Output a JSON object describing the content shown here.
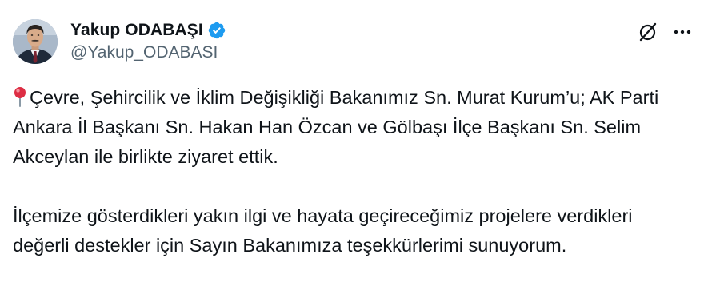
{
  "author": {
    "display_name": "Yakup ODABAŞI",
    "handle": "@Yakup_ODABASI",
    "verified": true
  },
  "icons": {
    "verified": "verified-badge-icon",
    "grok": "grok-icon",
    "more": "more-options-icon",
    "pin": "round-pushpin-emoji"
  },
  "tweet": {
    "paragraph_1": "Çevre, Şehircilik ve İklim Değişikliği Bakanımız Sn. Murat Kurum’u; AK Parti Ankara İl Başkanı Sn. Hakan Han Özcan ve Gölbaşı İlçe Başkanı Sn. Selim Akceylan ile birlikte ziyaret ettik.",
    "paragraph_2": "İlçemize gösterdikleri yakın ilgi ve hayata geçireceğimiz projelere verdikleri değerli destekler için Sayın Bakanımıza teşekkürlerimi sunuyorum."
  },
  "colors": {
    "verified_blue": "#1d9bf0",
    "text_primary": "#0f1419",
    "text_secondary": "#536471"
  }
}
